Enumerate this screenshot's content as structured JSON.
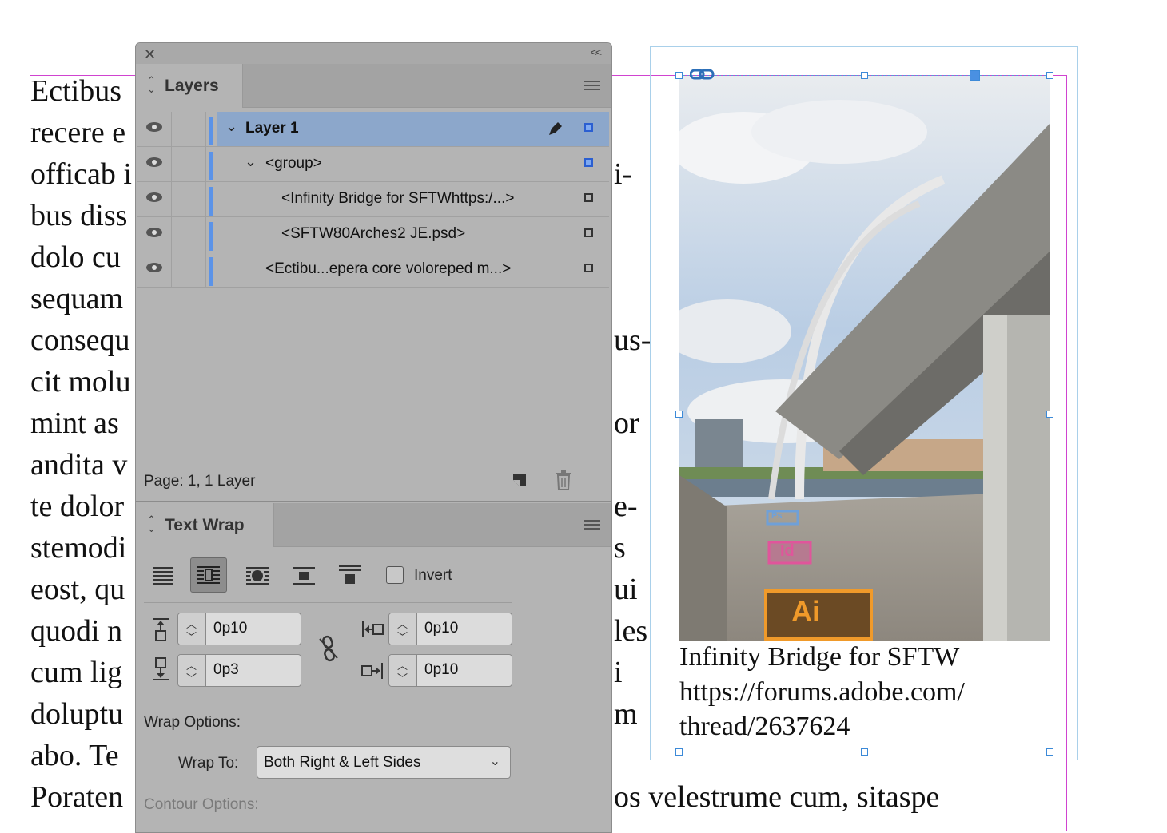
{
  "document": {
    "left_lines": [
      "Ectibus",
      "recere e",
      "officab i",
      "bus diss",
      "dolo cu",
      "sequam",
      "consequ",
      "cit molu",
      "mint as",
      "andita v",
      "te dolor",
      "stemodi",
      "eost, qu",
      "quodi n",
      "cum lig",
      "doluptu",
      "abo. Te"
    ],
    "right_fragments": [
      "i-",
      "us-",
      "or",
      "e-",
      "s",
      "ui",
      "les",
      "i",
      "m"
    ],
    "bottom_line_left": "Poraten",
    "bottom_line_right": "os velestrume cum, sitaspe",
    "caption_lines": [
      "Infinity Bridge for SFTW",
      "https://forums.adobe.com/",
      "thread/2637624"
    ],
    "photo_badges": [
      "Ps",
      "Id",
      "Ai"
    ]
  },
  "layers_panel": {
    "tab_label": "Layers",
    "rows": [
      {
        "name": "Layer 1"
      },
      {
        "name": "<group>"
      },
      {
        "name": "<Infinity Bridge for SFTWhttps:/...>"
      },
      {
        "name": "<SFTW80Arches2 JE.psd>"
      },
      {
        "name": "<Ectibu...epera core voloreped m...>"
      }
    ],
    "status": "Page: 1, 1 Layer"
  },
  "text_wrap_panel": {
    "tab_label": "Text Wrap",
    "invert_label": "Invert",
    "offsets": {
      "top": "0p10",
      "bottom": "0p3",
      "left": "0p10",
      "right": "0p10"
    },
    "wrap_options_label": "Wrap Options:",
    "wrap_to_label": "Wrap To:",
    "wrap_to_value": "Both Right & Left Sides",
    "contour_options_label": "Contour Options:"
  },
  "colors": {
    "selection": "#8ca7cb",
    "layer_color": "#5b93e8",
    "guide": "#d043d0",
    "frame": "#5a9ad8"
  }
}
